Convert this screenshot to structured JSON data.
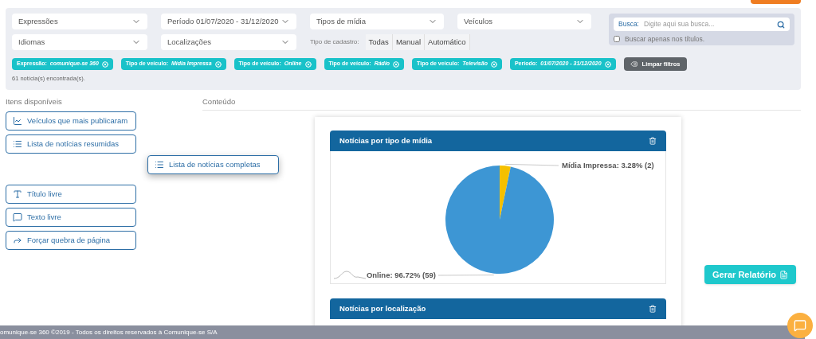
{
  "filters": {
    "selects_row_1": [
      "Expressões",
      "Período  01/07/2020 - 31/12/2020",
      "Tipos de mídia",
      "Veículos"
    ],
    "selects_row_2": [
      "Idiomas",
      "Localizações"
    ],
    "registration_type": {
      "label": "Tipo de cadastro:",
      "options": [
        "Todas",
        "Manual",
        "Automático"
      ]
    },
    "search": {
      "label": "Busca:",
      "placeholder": "Digite aqui sua busca...",
      "titles_only": {
        "label": "Buscar apenas nos títulos.",
        "checked": false
      }
    },
    "chips": [
      {
        "label": "Expressão:",
        "value": "comunique-se 360"
      },
      {
        "label": "Tipo de veículo:",
        "value": "Mídia Impressa"
      },
      {
        "label": "Tipo de veículo:",
        "value": "Online"
      },
      {
        "label": "Tipo de veículo:",
        "value": "Rádio"
      },
      {
        "label": "Tipo de veículo:",
        "value": "Televisão"
      },
      {
        "label": "Período:",
        "value": "01/07/2020 - 31/12/2020"
      }
    ],
    "clear_button": "Limpar filtros",
    "result_count": "61 notícia(s) encontrada(s)."
  },
  "available_items": {
    "title": "Itens disponíveis",
    "items": [
      {
        "label": "Veículos que mais publicaram",
        "kind": "chart",
        "dragging": false
      },
      {
        "label": "Lista de notícias resumidas",
        "kind": "list",
        "dragging": false
      },
      {
        "label": "Lista de notícias completas",
        "kind": "list",
        "dragging": true
      },
      {
        "label": "Título livre",
        "kind": "title",
        "dragging": false
      },
      {
        "label": "Texto livre",
        "kind": "text",
        "dragging": false
      },
      {
        "label": "Forçar quebra de página",
        "kind": "break",
        "dragging": false
      }
    ]
  },
  "content": {
    "title": "Conteúdo",
    "panels": [
      {
        "title": "Notícias por tipo de mídia",
        "chart_data": {
          "type": "pie",
          "categories": [
            "Mídia Impressa",
            "Online"
          ],
          "values": [
            3.28,
            96.72
          ],
          "colors": [
            "#f5c000",
            "#3d96d4"
          ],
          "value_labels": [
            "3.28% (2)",
            "96.72% (59)"
          ]
        }
      },
      {
        "title": "Notícias por localização"
      }
    ]
  },
  "generate_button": "Gerar Relatório",
  "footer": "omunique-se 360 ©2019 - Todos os direitos reservados à Comunique-se S/A"
}
